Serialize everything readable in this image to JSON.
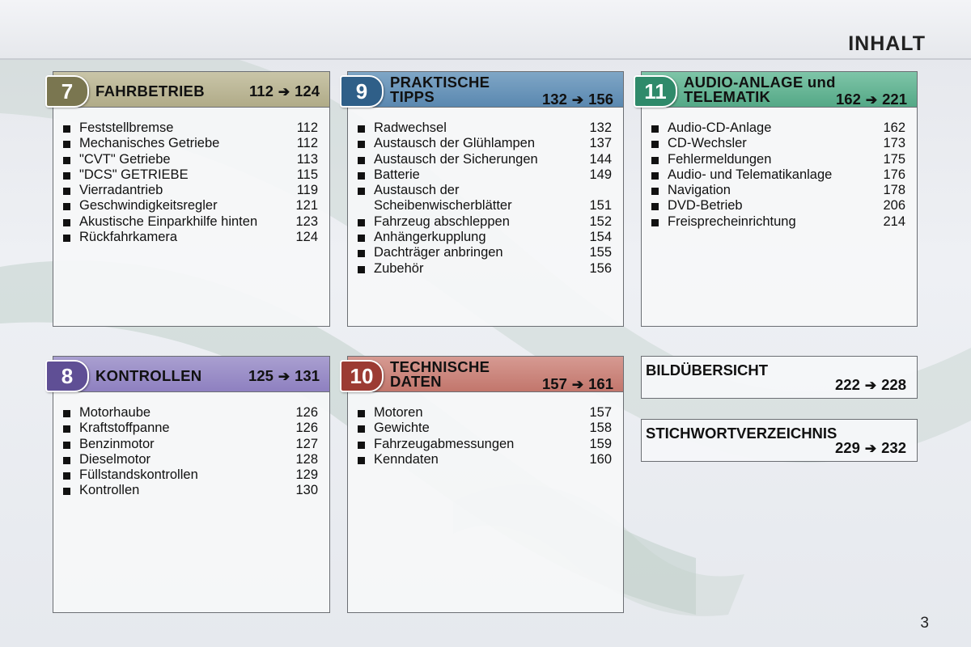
{
  "page": {
    "title": "INHALT",
    "number": "3"
  },
  "chapters": [
    {
      "num": "7",
      "title_line1": "FAHRBETRIEB",
      "title_line2": "",
      "range_from": "112",
      "range_to": "124",
      "color": "#7a7650",
      "items": [
        {
          "label": "Feststellbremse",
          "page": "112"
        },
        {
          "label": "Mechanisches Getriebe",
          "page": "112"
        },
        {
          "label": "\"CVT\" Getriebe",
          "page": "113"
        },
        {
          "label": "\"DCS\" GETRIEBE",
          "page": "115"
        },
        {
          "label": "Vierradantrieb",
          "page": "119"
        },
        {
          "label": "Geschwindigkeitsregler",
          "page": "121"
        },
        {
          "label": "Akustische Einparkhilfe hinten",
          "page": "123"
        },
        {
          "label": "Rückfahrkamera",
          "page": "124"
        }
      ]
    },
    {
      "num": "8",
      "title_line1": "KONTROLLEN",
      "title_line2": "",
      "range_from": "125",
      "range_to": "131",
      "color": "#5f4f95",
      "items": [
        {
          "label": "Motorhaube",
          "page": "126"
        },
        {
          "label": "Kraftstoffpanne",
          "page": "126"
        },
        {
          "label": "Benzinmotor",
          "page": "127"
        },
        {
          "label": "Dieselmotor",
          "page": "128"
        },
        {
          "label": "Füllstandskontrollen",
          "page": "129"
        },
        {
          "label": "Kontrollen",
          "page": "130"
        }
      ]
    },
    {
      "num": "9",
      "title_line1": "PRAKTISCHE",
      "title_line2": "TIPPS",
      "range_from": "132",
      "range_to": "156",
      "color": "#2f5f88",
      "items": [
        {
          "label": "Radwechsel",
          "page": "132"
        },
        {
          "label": "Austausch der Glühlampen",
          "page": "137"
        },
        {
          "label": "Austausch der Sicherungen",
          "page": "144"
        },
        {
          "label": "Batterie",
          "page": "149"
        },
        {
          "label": "Austausch der",
          "page": ""
        },
        {
          "label": "Scheibenwischerblätter",
          "page": "151"
        },
        {
          "label": "Fahrzeug abschleppen",
          "page": "152"
        },
        {
          "label": "Anhängerkupplung",
          "page": "154"
        },
        {
          "label": "Dachträger anbringen",
          "page": "155"
        },
        {
          "label": "Zubehör",
          "page": "156"
        }
      ]
    },
    {
      "num": "10",
      "title_line1": "TECHNISCHE",
      "title_line2": "DATEN",
      "range_from": "157",
      "range_to": "161",
      "color": "#9c3b33",
      "items": [
        {
          "label": "Motoren",
          "page": "157"
        },
        {
          "label": "Gewichte",
          "page": "158"
        },
        {
          "label": "Fahrzeugabmessungen",
          "page": "159"
        },
        {
          "label": "Kenndaten",
          "page": "160"
        }
      ]
    },
    {
      "num": "11",
      "title_line1": "AUDIO-ANLAGE und",
      "title_line2": "TELEMATIK",
      "range_from": "162",
      "range_to": "221",
      "color": "#2f8a6a",
      "items": [
        {
          "label": "Audio-CD-Anlage",
          "page": "162"
        },
        {
          "label": "CD-Wechsler",
          "page": "173"
        },
        {
          "label": "Fehlermeldungen",
          "page": "175"
        },
        {
          "label": "Audio- und Telematikanlage",
          "page": "176"
        },
        {
          "label": "Navigation",
          "page": "178"
        },
        {
          "label": "DVD-Betrieb",
          "page": "206"
        },
        {
          "label": "Freisprecheinrichtung",
          "page": "214"
        }
      ]
    }
  ],
  "extras": [
    {
      "title": "BILDÜBERSICHT",
      "range_from": "222",
      "range_to": "228"
    },
    {
      "title": "STICHWORTVERZEICHNIS",
      "range_from": "229",
      "range_to": "232"
    }
  ]
}
